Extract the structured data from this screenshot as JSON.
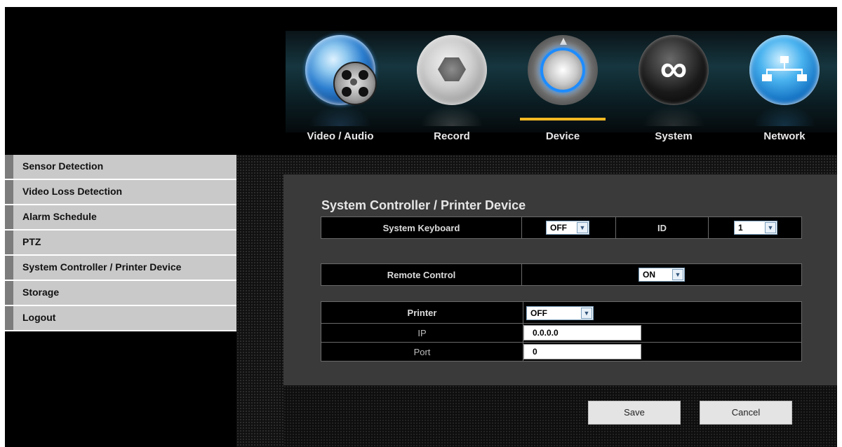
{
  "nav": {
    "items": [
      {
        "label": "Video / Audio",
        "icon": "video-reel-icon"
      },
      {
        "label": "Record",
        "icon": "camera-aperture-icon"
      },
      {
        "label": "Device",
        "icon": "device-dial-icon"
      },
      {
        "label": "System",
        "icon": "system-link-icon"
      },
      {
        "label": "Network",
        "icon": "network-topology-icon"
      }
    ],
    "active": "Device",
    "active_color": "#f2b823"
  },
  "sidebar": {
    "items": [
      {
        "label": "Sensor Detection"
      },
      {
        "label": "Video Loss Detection"
      },
      {
        "label": "Alarm Schedule"
      },
      {
        "label": "PTZ"
      },
      {
        "label": "System Controller / Printer Device"
      },
      {
        "label": "Storage"
      },
      {
        "label": "Logout"
      }
    ]
  },
  "panel": {
    "title": "System Controller / Printer Device",
    "keyboard": {
      "label": "System Keyboard",
      "value": "OFF",
      "id_label": "ID",
      "id_value": "1"
    },
    "remote": {
      "label": "Remote Control",
      "value": "ON"
    },
    "printer": {
      "label": "Printer",
      "value": "OFF",
      "ip_label": "IP",
      "ip_value": "0.0.0.0",
      "port_label": "Port",
      "port_value": "0"
    }
  },
  "buttons": {
    "save": "Save",
    "cancel": "Cancel"
  }
}
